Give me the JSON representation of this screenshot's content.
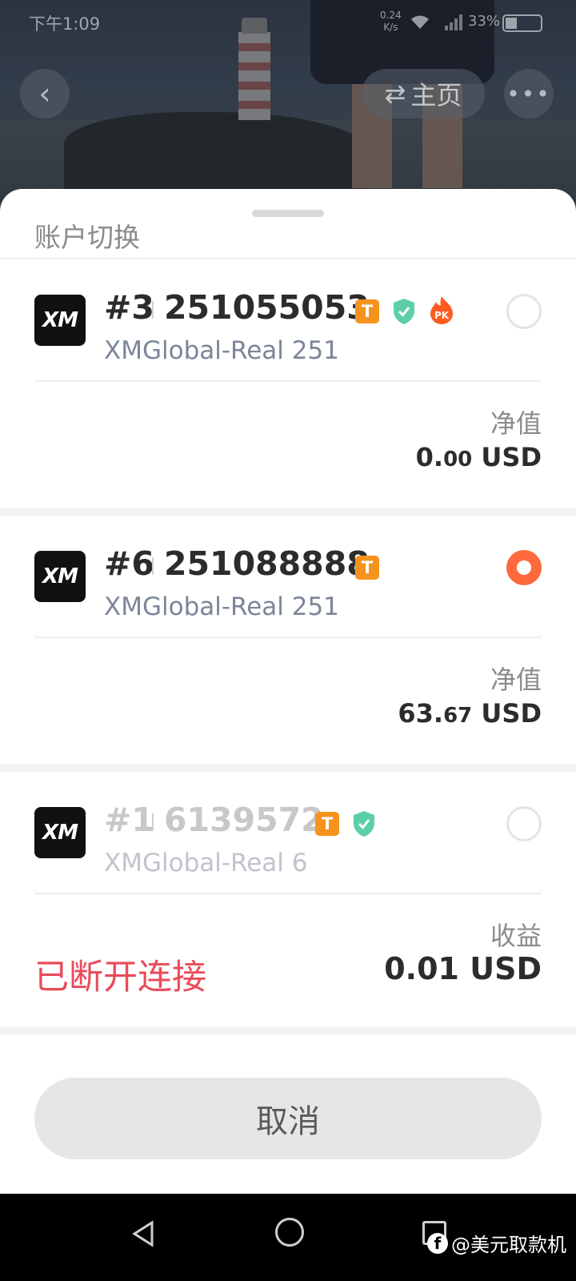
{
  "status_bar": {
    "time": "下午1:09",
    "net_speed_value": "0.24",
    "net_speed_unit": "K/s",
    "battery": "33%"
  },
  "header": {
    "home_label": "主页",
    "home_icon": "swap-arrows-icon",
    "back_icon": "chevron-left-icon",
    "more_icon": "more-dots-icon"
  },
  "sheet": {
    "title": "账户切换",
    "accounts": [
      {
        "index": "#3",
        "number": "251055053",
        "server": "XMGlobal-Real 251",
        "badges": [
          "T",
          "shield-verified",
          "pk-fire"
        ],
        "selected": false,
        "metric_label": "净值",
        "metric_int": "0.",
        "metric_cents": "00",
        "metric_unit": "USD"
      },
      {
        "index": "#6",
        "number": "251088888",
        "server": "XMGlobal-Real 251",
        "badges": [
          "T"
        ],
        "selected": true,
        "metric_label": "净值",
        "metric_int": "63.",
        "metric_cents": "67",
        "metric_unit": "USD"
      },
      {
        "index": "#1",
        "number": "6139572",
        "server": "XMGlobal-Real 6",
        "badges": [
          "T",
          "shield-verified"
        ],
        "selected": false,
        "metric_label": "收益",
        "metric_value": "0.01 USD",
        "status": "已断开连接"
      }
    ],
    "logo_text": "XM",
    "cancel_label": "取消"
  },
  "watermark": "@美元取款机",
  "colors": {
    "accent": "#ff6a3d",
    "badge_t": "#f6921e",
    "shield": "#5ccfa8",
    "disconnected": "#e94b5a",
    "server_text": "#7b8699"
  }
}
